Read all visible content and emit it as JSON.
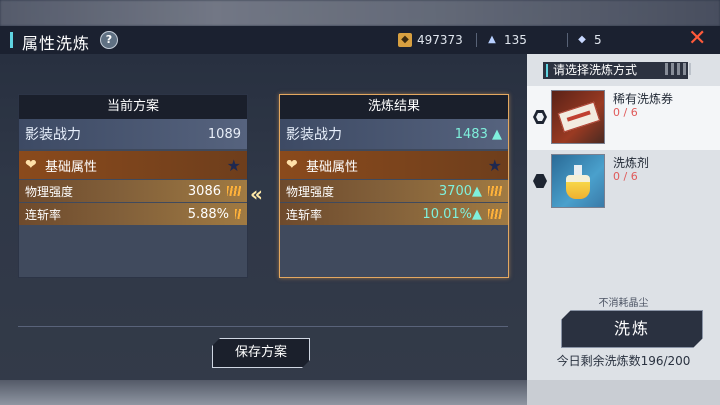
{
  "header": {
    "title": "属性洗炼",
    "help_label": "?",
    "currencies": [
      {
        "icon": "coin-icon",
        "value": "497373"
      },
      {
        "icon": "crystal-dust-icon",
        "value": "135"
      },
      {
        "icon": "diamond-icon",
        "value": "5"
      }
    ],
    "close_label": "✕"
  },
  "current": {
    "header": "当前方案",
    "power_label": "影装战力",
    "power_value": "1089",
    "section_label": "基础属性",
    "attributes": [
      {
        "name": "物理强度",
        "value": "3086"
      },
      {
        "name": "连斩率",
        "value": "5.88%"
      }
    ]
  },
  "result": {
    "header": "洗炼结果",
    "power_label": "影装战力",
    "power_value": "1483",
    "section_label": "基础属性",
    "attributes": [
      {
        "name": "物理强度",
        "value": "3700"
      },
      {
        "name": "连斩率",
        "value": "10.01%"
      }
    ]
  },
  "arrow_label": "«",
  "save_button": "保存方案",
  "panel": {
    "prompt": "请选择洗炼方式",
    "options": [
      {
        "name": "稀有洗炼券",
        "count": "0 / 6",
        "icon": "rare-ticket-icon",
        "selected": true
      },
      {
        "name": "洗炼剂",
        "count": "0 / 6",
        "icon": "potion-icon",
        "selected": false
      }
    ],
    "cost_note": "不消耗晶尘",
    "wash_button": "洗炼",
    "remaining": "今日剩余洗炼数196/200"
  }
}
